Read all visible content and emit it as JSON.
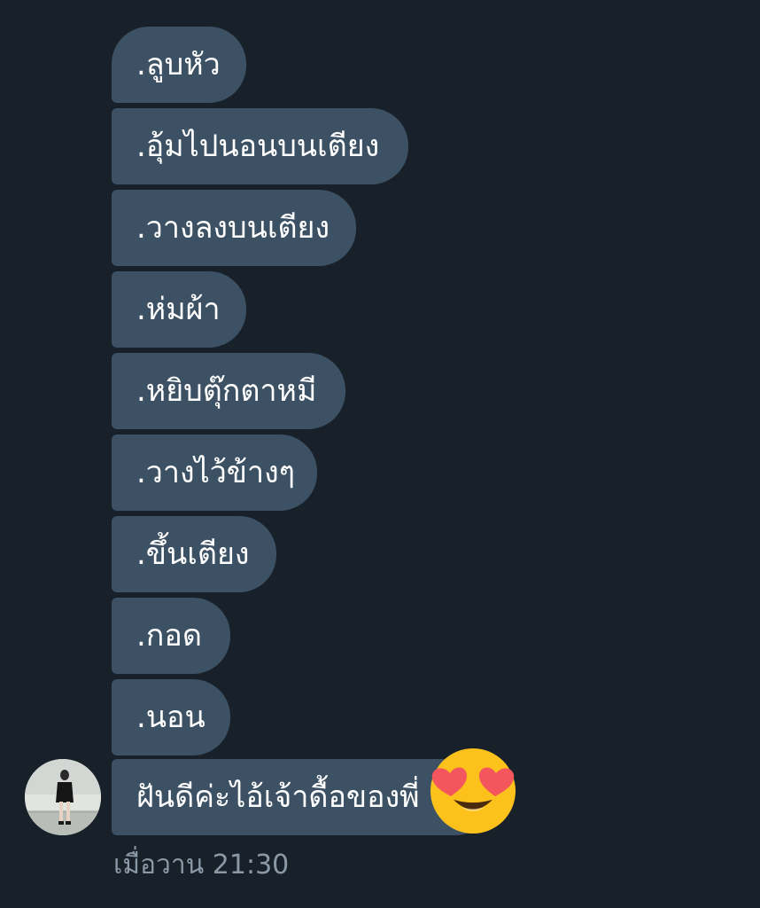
{
  "messages": [
    {
      "text": ".ลูบหัว"
    },
    {
      "text": ".อุ้มไปนอนบนเตียง"
    },
    {
      "text": ".วางลงบนเตียง"
    },
    {
      "text": ".ห่มผ้า"
    },
    {
      "text": ".หยิบตุ๊กตาหมี"
    },
    {
      "text": ".วางไว้ข้างๆ"
    },
    {
      "text": ".ขึ้นเตียง"
    },
    {
      "text": ".กอด"
    },
    {
      "text": ".นอน"
    },
    {
      "text": "ฝันดีค่ะไอ้เจ้าดื้อของพี่"
    }
  ],
  "emoji": "smiling-face-with-heart-eyes-icon",
  "timestamp": "เมื่อวาน 21:30",
  "colors": {
    "background": "#18202a",
    "bubble": "#3d5164",
    "text": "#ffffff",
    "timestamp": "#8b98a6"
  }
}
